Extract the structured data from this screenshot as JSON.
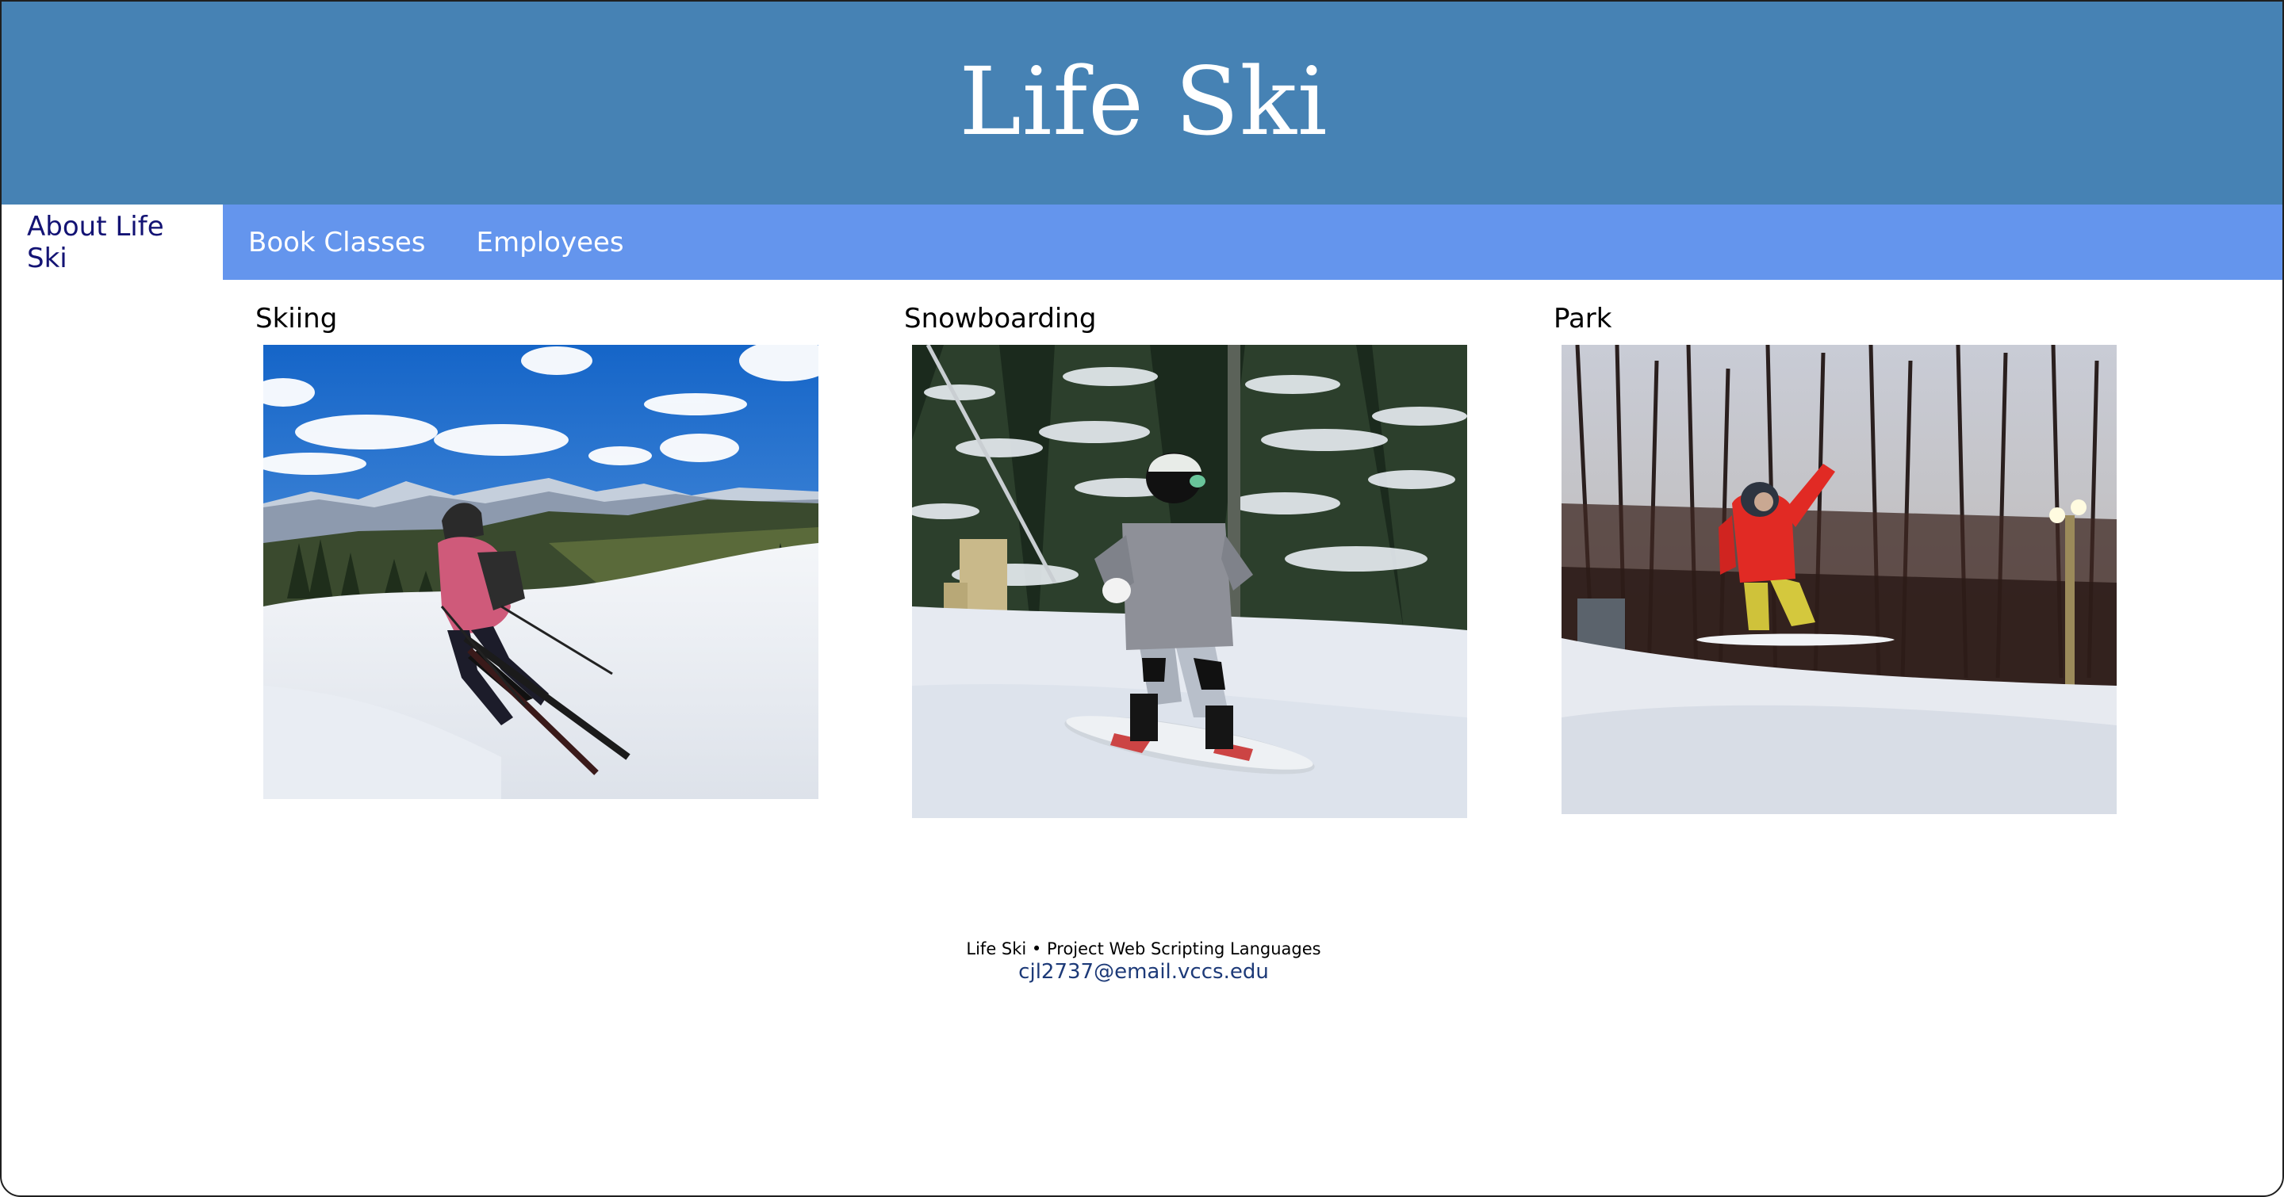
{
  "header": {
    "title": "Life Ski"
  },
  "nav": {
    "items": [
      {
        "label": "About Life Ski",
        "active": true
      },
      {
        "label": "Book Classes",
        "active": false
      },
      {
        "label": "Employees",
        "active": false
      }
    ]
  },
  "gallery": {
    "cards": [
      {
        "title": "Skiing",
        "image": "skier-on-slope-photo"
      },
      {
        "title": "Snowboarding",
        "image": "snowboarder-in-forest-photo"
      },
      {
        "title": "Park",
        "image": "snowboard-jump-photo"
      }
    ]
  },
  "footer": {
    "credit": "Life Ski • Project Web Scripting Languages",
    "email": "cjl2737@email.vccs.edu"
  },
  "colors": {
    "banner": "#4682b4",
    "navbar": "#6495ed",
    "active_tab_text": "#131374",
    "link": "#1d3a78"
  }
}
